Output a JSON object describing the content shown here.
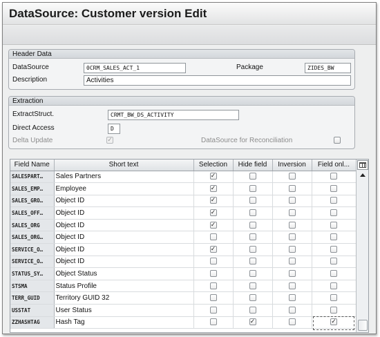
{
  "window": {
    "title": "DataSource: Customer version Edit"
  },
  "header_data": {
    "title": "Header Data",
    "datasource": {
      "label": "DataSource",
      "value": "0CRM_SALES_ACT_1"
    },
    "package": {
      "label": "Package",
      "value": "ZIDES_BW"
    },
    "description": {
      "label": "Description",
      "value": "Activities"
    }
  },
  "extraction": {
    "title": "Extraction",
    "extract_struct": {
      "label": "ExtractStruct.",
      "value": "CRMT_BW_DS_ACTIVITY"
    },
    "direct_access": {
      "label": "Direct Access",
      "value": "D"
    },
    "delta_update": {
      "label": "Delta Update",
      "checked": true
    },
    "reconciliation": {
      "label": "DataSource for Reconciliation",
      "checked": false
    }
  },
  "table": {
    "columns": [
      "Field Name",
      "Short text",
      "Selection",
      "Hide field",
      "Inversion",
      "Field onl..."
    ],
    "settings_icon": "table-settings-icon",
    "rows": [
      {
        "field": "SALESPART…",
        "text": "Sales Partners",
        "selection": true,
        "hide": false,
        "inversion": false,
        "field_only": false
      },
      {
        "field": "SALES_EMP…",
        "text": "Employee",
        "selection": true,
        "hide": false,
        "inversion": false,
        "field_only": false
      },
      {
        "field": "SALES_GRO…",
        "text": "Object ID",
        "selection": true,
        "hide": false,
        "inversion": false,
        "field_only": false
      },
      {
        "field": "SALES_OFF…",
        "text": "Object ID",
        "selection": true,
        "hide": false,
        "inversion": false,
        "field_only": false
      },
      {
        "field": "SALES_ORG",
        "text": "Object ID",
        "selection": true,
        "hide": false,
        "inversion": false,
        "field_only": false
      },
      {
        "field": "SALES_ORG…",
        "text": "Object ID",
        "selection": false,
        "hide": false,
        "inversion": false,
        "field_only": false
      },
      {
        "field": "SERVICE_O…",
        "text": "Object ID",
        "selection": true,
        "hide": false,
        "inversion": false,
        "field_only": false
      },
      {
        "field": "SERVICE_O…",
        "text": "Object ID",
        "selection": false,
        "hide": false,
        "inversion": false,
        "field_only": false
      },
      {
        "field": "STATUS_SY…",
        "text": "Object Status",
        "selection": false,
        "hide": false,
        "inversion": false,
        "field_only": false
      },
      {
        "field": "STSMA",
        "text": "Status Profile",
        "selection": false,
        "hide": false,
        "inversion": false,
        "field_only": false
      },
      {
        "field": "TERR_GUID",
        "text": "Territory GUID 32",
        "selection": false,
        "hide": false,
        "inversion": false,
        "field_only": false
      },
      {
        "field": "USSTAT",
        "text": "User Status",
        "selection": false,
        "hide": false,
        "inversion": false,
        "field_only": false
      },
      {
        "field": "ZZHASHTAG",
        "text": "Hash Tag",
        "selection": false,
        "hide": true,
        "inversion": false,
        "field_only": true
      }
    ]
  }
}
